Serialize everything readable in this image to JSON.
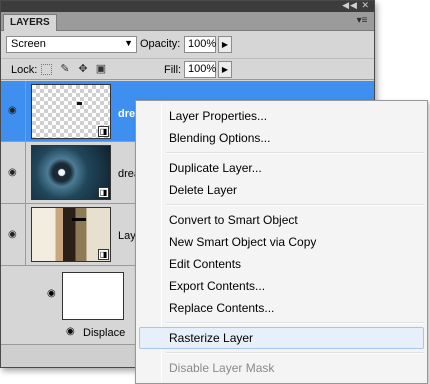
{
  "panel": {
    "tab_label": "LAYERS",
    "title_buttons": "◀◀ ✕",
    "menu_glyph": "▾≡"
  },
  "controls": {
    "blend_mode": "Screen",
    "opacity_label": "Opacity:",
    "opacity_value": "100%",
    "lock_label": "Lock:",
    "fill_label": "Fill:",
    "fill_value": "100%"
  },
  "layers": [
    {
      "name": "dre",
      "selected": true,
      "thumb": "transparent-checker"
    },
    {
      "name": "drea",
      "selected": false,
      "thumb": "shattered-glass"
    },
    {
      "name": "Laye",
      "selected": false,
      "thumb": "man-with-gun-photo"
    }
  ],
  "smart_filter": {
    "thumb": "white-mask",
    "filter_name": "Displace"
  },
  "context_menu": {
    "items": [
      {
        "label": "Layer Properties...",
        "disabled": false
      },
      {
        "label": "Blending Options...",
        "disabled": false
      },
      {
        "label": "Duplicate Layer...",
        "disabled": false
      },
      {
        "label": "Delete Layer",
        "disabled": false
      },
      {
        "label": "Convert to Smart Object",
        "disabled": false
      },
      {
        "label": "New Smart Object via Copy",
        "disabled": false
      },
      {
        "label": "Edit Contents",
        "disabled": false
      },
      {
        "label": "Export Contents...",
        "disabled": false
      },
      {
        "label": "Replace Contents...",
        "disabled": false
      },
      {
        "label": "Rasterize Layer",
        "disabled": false,
        "highlighted": true
      },
      {
        "label": "Disable Layer Mask",
        "disabled": true
      }
    ]
  },
  "colors": {
    "selection": "#3e8ff0",
    "panel_bg": "#d6d6d6",
    "menu_bg": "#f4f4f4",
    "menu_highlight": "#e7f0fa"
  }
}
